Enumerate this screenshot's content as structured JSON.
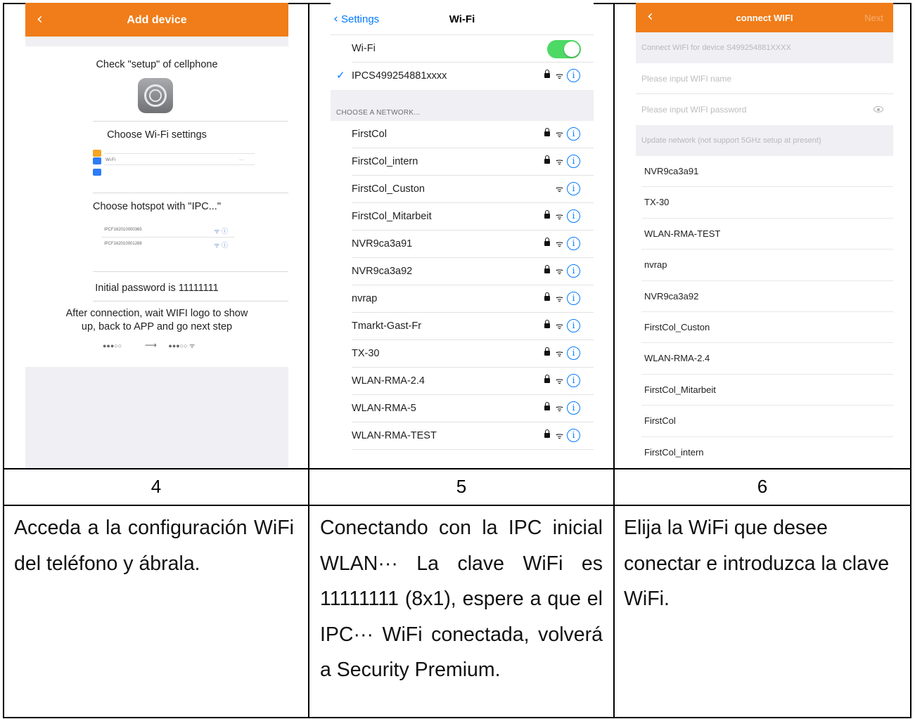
{
  "panel4": {
    "title": "Add device",
    "step1": "Check \"setup\" of cellphone",
    "step2": "Choose Wi-Fi settings",
    "mini_wifi_label": "Wi-Fi",
    "mini_wifi_value": "···",
    "step3": "Choose hotspot with \"IPC...\"",
    "hotspots": [
      "IPCF162010000365",
      "IPCF162010001288"
    ],
    "step4": "Initial password is 11111111",
    "step5_line1": "After connection, wait WIFI logo to show",
    "step5_line2": "up, back to APP and go next step",
    "signal_from": "●●●○○",
    "arrow": "⟶",
    "signal_to": "●●●○○ ᯤ"
  },
  "panel5": {
    "back_label": "Settings",
    "title": "Wi-Fi",
    "wifi_label": "Wi-Fi",
    "connected_network": "IPCS499254881xxxx",
    "section_header": "CHOOSE A NETWORK...",
    "networks": [
      {
        "name": "FirstCol",
        "locked": true
      },
      {
        "name": "FirstCol_intern",
        "locked": true
      },
      {
        "name": "FirstCol_Custon",
        "locked": false
      },
      {
        "name": "FirstCol_Mitarbeit",
        "locked": true
      },
      {
        "name": "NVR9ca3a91",
        "locked": true
      },
      {
        "name": "NVR9ca3a92",
        "locked": true
      },
      {
        "name": "nvrap",
        "locked": true
      },
      {
        "name": "Tmarkt-Gast-Fr",
        "locked": true
      },
      {
        "name": "TX-30",
        "locked": true
      },
      {
        "name": "WLAN-RMA-2.4",
        "locked": true
      },
      {
        "name": "WLAN-RMA-5",
        "locked": true
      },
      {
        "name": "WLAN-RMA-TEST",
        "locked": true
      }
    ]
  },
  "panel6": {
    "title": "connect WIFI",
    "next_label": "Next",
    "device_hint": "Connect WIFI for device S499254881XXXX",
    "name_placeholder": "Please input WIFI name",
    "password_placeholder": "Please input WIFI password",
    "update_hint": "Update network (not support 5GHz setup at present)",
    "networks": [
      "NVR9ca3a91",
      "TX-30",
      "WLAN-RMA-TEST",
      "nvrap",
      "NVR9ca3a92",
      "FirstCol_Custon",
      "WLAN-RMA-2.4",
      "FirstCol_Mitarbeit",
      "FirstCol",
      "FirstCol_intern"
    ]
  },
  "numbers": [
    "4",
    "5",
    "6"
  ],
  "descriptions": [
    "Acceda a la configuración WiFi del teléfono y ábrala.",
    "Conectando con la IPC inicial WLAN··· La clave WiFi es 11111111 (8x1), espere a que el IPC··· WiFi conectada, volverá a Security Premium.",
    "Elija la WiFi que desee conectar e introduzca la clave WiFi."
  ],
  "colors": {
    "accent_orange": "#f07d19",
    "ios_blue": "#007aff",
    "toggle_green": "#4cd964"
  }
}
